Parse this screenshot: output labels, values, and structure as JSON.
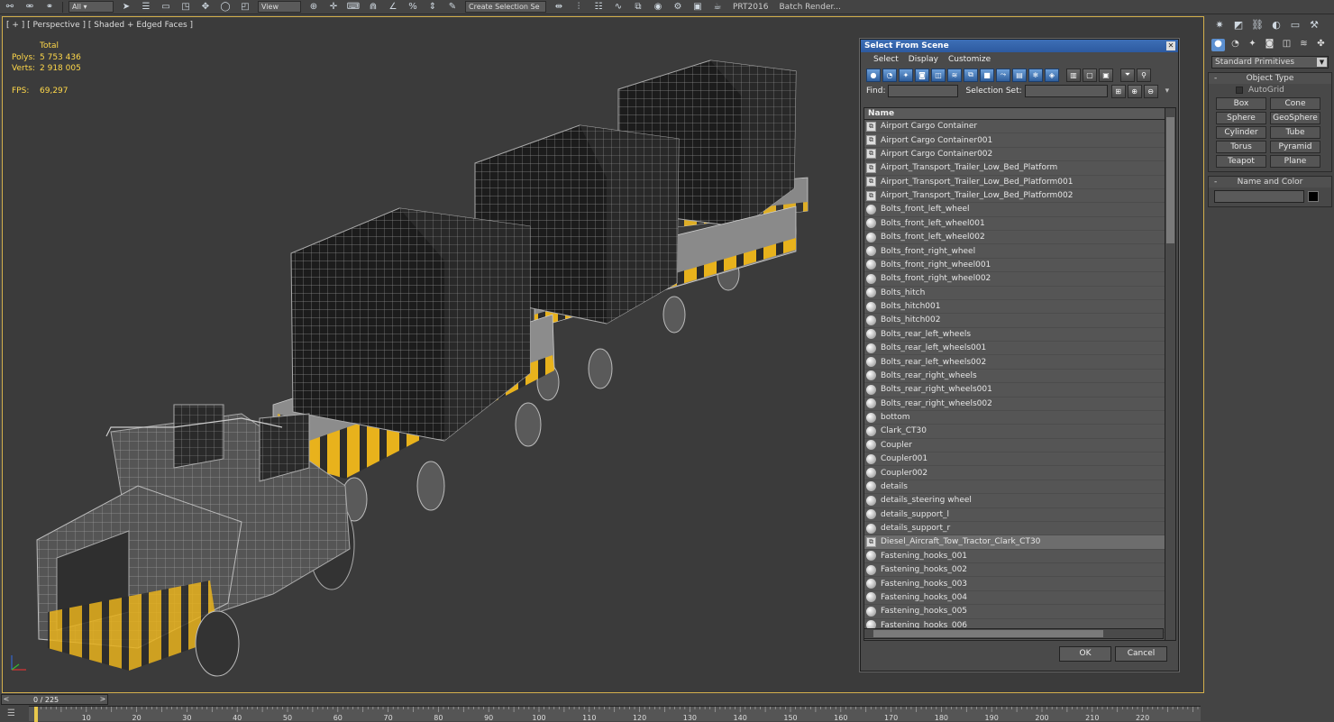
{
  "toolbar": {
    "view_dropdown": "View",
    "selection_set_dropdown": "Create Selection Se",
    "prt_label": "PRT2016",
    "batch_render_label": "Batch Render..."
  },
  "viewport": {
    "label": "[ + ] [ Perspective ] [ Shaded + Edged Faces ]",
    "stats": {
      "total_label": "Total",
      "polys_label": "Polys:",
      "polys_value": "5 753 436",
      "verts_label": "Verts:",
      "verts_value": "2 918 005",
      "fps_label": "FPS:",
      "fps_value": "69,297"
    }
  },
  "dialog": {
    "title": "Select From Scene",
    "menu": [
      "Select",
      "Display",
      "Customize"
    ],
    "find_label": "Find:",
    "selection_set_label": "Selection Set:",
    "column_header": "Name",
    "items": [
      {
        "name": "Airport Cargo Container",
        "icon": "group-icon"
      },
      {
        "name": "Airport Cargo Container001",
        "icon": "group-icon"
      },
      {
        "name": "Airport Cargo Container002",
        "icon": "group-icon"
      },
      {
        "name": "Airport_Transport_Trailer_Low_Bed_Platform",
        "icon": "group-icon"
      },
      {
        "name": "Airport_Transport_Trailer_Low_Bed_Platform001",
        "icon": "group-icon"
      },
      {
        "name": "Airport_Transport_Trailer_Low_Bed_Platform002",
        "icon": "group-icon"
      },
      {
        "name": "Bolts_front_left_wheel",
        "icon": "geometry-icon"
      },
      {
        "name": "Bolts_front_left_wheel001",
        "icon": "geometry-icon"
      },
      {
        "name": "Bolts_front_left_wheel002",
        "icon": "geometry-icon"
      },
      {
        "name": "Bolts_front_right_wheel",
        "icon": "geometry-icon"
      },
      {
        "name": "Bolts_front_right_wheel001",
        "icon": "geometry-icon"
      },
      {
        "name": "Bolts_front_right_wheel002",
        "icon": "geometry-icon"
      },
      {
        "name": "Bolts_hitch",
        "icon": "geometry-icon"
      },
      {
        "name": "Bolts_hitch001",
        "icon": "geometry-icon"
      },
      {
        "name": "Bolts_hitch002",
        "icon": "geometry-icon"
      },
      {
        "name": "Bolts_rear_left_wheels",
        "icon": "geometry-icon"
      },
      {
        "name": "Bolts_rear_left_wheels001",
        "icon": "geometry-icon"
      },
      {
        "name": "Bolts_rear_left_wheels002",
        "icon": "geometry-icon"
      },
      {
        "name": "Bolts_rear_right_wheels",
        "icon": "geometry-icon"
      },
      {
        "name": "Bolts_rear_right_wheels001",
        "icon": "geometry-icon"
      },
      {
        "name": "Bolts_rear_right_wheels002",
        "icon": "geometry-icon"
      },
      {
        "name": "bottom",
        "icon": "geometry-icon"
      },
      {
        "name": "Clark_CT30",
        "icon": "geometry-icon"
      },
      {
        "name": "Coupler",
        "icon": "geometry-icon"
      },
      {
        "name": "Coupler001",
        "icon": "geometry-icon"
      },
      {
        "name": "Coupler002",
        "icon": "geometry-icon"
      },
      {
        "name": "details",
        "icon": "geometry-icon"
      },
      {
        "name": "details_steering wheel",
        "icon": "geometry-icon"
      },
      {
        "name": "details_support_l",
        "icon": "geometry-icon"
      },
      {
        "name": "details_support_r",
        "icon": "geometry-icon"
      },
      {
        "name": "Diesel_Aircraft_Tow_Tractor_Clark_CT30",
        "icon": "group-icon",
        "selected": true
      },
      {
        "name": "Fastening_hooks_001",
        "icon": "geometry-icon"
      },
      {
        "name": "Fastening_hooks_002",
        "icon": "geometry-icon"
      },
      {
        "name": "Fastening_hooks_003",
        "icon": "geometry-icon"
      },
      {
        "name": "Fastening_hooks_004",
        "icon": "geometry-icon"
      },
      {
        "name": "Fastening_hooks_005",
        "icon": "geometry-icon"
      },
      {
        "name": "Fastening_hooks_006",
        "icon": "geometry-icon"
      }
    ],
    "ok_label": "OK",
    "cancel_label": "Cancel"
  },
  "command_panel": {
    "category_dropdown": "Standard Primitives",
    "object_type_title": "Object Type",
    "autogrid_label": "AutoGrid",
    "primitives": [
      "Box",
      "Cone",
      "Sphere",
      "GeoSphere",
      "Cylinder",
      "Tube",
      "Torus",
      "Pyramid",
      "Teapot",
      "Plane"
    ],
    "name_color_title": "Name and Color"
  },
  "timeline": {
    "frame_display": "0 / 225",
    "ticks": [
      "10",
      "20",
      "30",
      "40",
      "50",
      "60",
      "70",
      "80",
      "90",
      "100",
      "110",
      "120",
      "130",
      "140",
      "150",
      "160",
      "170",
      "180",
      "190",
      "200",
      "210",
      "220"
    ]
  },
  "colors": {
    "viewport_border": "#d4b04c",
    "stats_text": "#ffd84a",
    "title_bar": "#2d5aa0",
    "accent_yellow": "#e8b21c"
  }
}
